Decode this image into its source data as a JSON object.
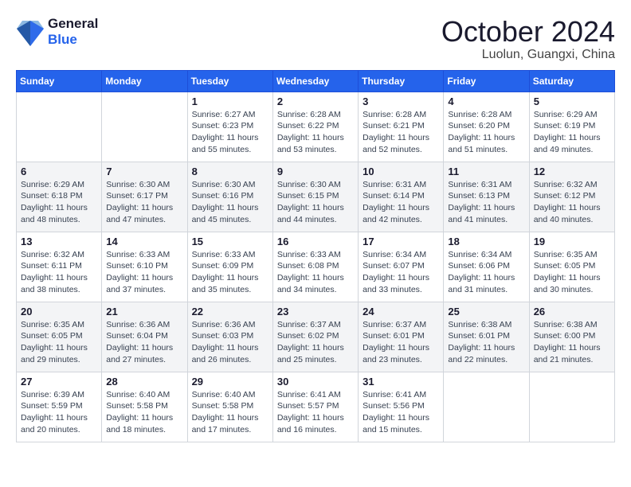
{
  "header": {
    "logo_line1": "General",
    "logo_line2": "Blue",
    "month": "October 2024",
    "location": "Luolun, Guangxi, China"
  },
  "weekdays": [
    "Sunday",
    "Monday",
    "Tuesday",
    "Wednesday",
    "Thursday",
    "Friday",
    "Saturday"
  ],
  "weeks": [
    [
      {
        "day": "",
        "info": ""
      },
      {
        "day": "",
        "info": ""
      },
      {
        "day": "1",
        "info": "Sunrise: 6:27 AM\nSunset: 6:23 PM\nDaylight: 11 hours and 55 minutes."
      },
      {
        "day": "2",
        "info": "Sunrise: 6:28 AM\nSunset: 6:22 PM\nDaylight: 11 hours and 53 minutes."
      },
      {
        "day": "3",
        "info": "Sunrise: 6:28 AM\nSunset: 6:21 PM\nDaylight: 11 hours and 52 minutes."
      },
      {
        "day": "4",
        "info": "Sunrise: 6:28 AM\nSunset: 6:20 PM\nDaylight: 11 hours and 51 minutes."
      },
      {
        "day": "5",
        "info": "Sunrise: 6:29 AM\nSunset: 6:19 PM\nDaylight: 11 hours and 49 minutes."
      }
    ],
    [
      {
        "day": "6",
        "info": "Sunrise: 6:29 AM\nSunset: 6:18 PM\nDaylight: 11 hours and 48 minutes."
      },
      {
        "day": "7",
        "info": "Sunrise: 6:30 AM\nSunset: 6:17 PM\nDaylight: 11 hours and 47 minutes."
      },
      {
        "day": "8",
        "info": "Sunrise: 6:30 AM\nSunset: 6:16 PM\nDaylight: 11 hours and 45 minutes."
      },
      {
        "day": "9",
        "info": "Sunrise: 6:30 AM\nSunset: 6:15 PM\nDaylight: 11 hours and 44 minutes."
      },
      {
        "day": "10",
        "info": "Sunrise: 6:31 AM\nSunset: 6:14 PM\nDaylight: 11 hours and 42 minutes."
      },
      {
        "day": "11",
        "info": "Sunrise: 6:31 AM\nSunset: 6:13 PM\nDaylight: 11 hours and 41 minutes."
      },
      {
        "day": "12",
        "info": "Sunrise: 6:32 AM\nSunset: 6:12 PM\nDaylight: 11 hours and 40 minutes."
      }
    ],
    [
      {
        "day": "13",
        "info": "Sunrise: 6:32 AM\nSunset: 6:11 PM\nDaylight: 11 hours and 38 minutes."
      },
      {
        "day": "14",
        "info": "Sunrise: 6:33 AM\nSunset: 6:10 PM\nDaylight: 11 hours and 37 minutes."
      },
      {
        "day": "15",
        "info": "Sunrise: 6:33 AM\nSunset: 6:09 PM\nDaylight: 11 hours and 35 minutes."
      },
      {
        "day": "16",
        "info": "Sunrise: 6:33 AM\nSunset: 6:08 PM\nDaylight: 11 hours and 34 minutes."
      },
      {
        "day": "17",
        "info": "Sunrise: 6:34 AM\nSunset: 6:07 PM\nDaylight: 11 hours and 33 minutes."
      },
      {
        "day": "18",
        "info": "Sunrise: 6:34 AM\nSunset: 6:06 PM\nDaylight: 11 hours and 31 minutes."
      },
      {
        "day": "19",
        "info": "Sunrise: 6:35 AM\nSunset: 6:05 PM\nDaylight: 11 hours and 30 minutes."
      }
    ],
    [
      {
        "day": "20",
        "info": "Sunrise: 6:35 AM\nSunset: 6:05 PM\nDaylight: 11 hours and 29 minutes."
      },
      {
        "day": "21",
        "info": "Sunrise: 6:36 AM\nSunset: 6:04 PM\nDaylight: 11 hours and 27 minutes."
      },
      {
        "day": "22",
        "info": "Sunrise: 6:36 AM\nSunset: 6:03 PM\nDaylight: 11 hours and 26 minutes."
      },
      {
        "day": "23",
        "info": "Sunrise: 6:37 AM\nSunset: 6:02 PM\nDaylight: 11 hours and 25 minutes."
      },
      {
        "day": "24",
        "info": "Sunrise: 6:37 AM\nSunset: 6:01 PM\nDaylight: 11 hours and 23 minutes."
      },
      {
        "day": "25",
        "info": "Sunrise: 6:38 AM\nSunset: 6:01 PM\nDaylight: 11 hours and 22 minutes."
      },
      {
        "day": "26",
        "info": "Sunrise: 6:38 AM\nSunset: 6:00 PM\nDaylight: 11 hours and 21 minutes."
      }
    ],
    [
      {
        "day": "27",
        "info": "Sunrise: 6:39 AM\nSunset: 5:59 PM\nDaylight: 11 hours and 20 minutes."
      },
      {
        "day": "28",
        "info": "Sunrise: 6:40 AM\nSunset: 5:58 PM\nDaylight: 11 hours and 18 minutes."
      },
      {
        "day": "29",
        "info": "Sunrise: 6:40 AM\nSunset: 5:58 PM\nDaylight: 11 hours and 17 minutes."
      },
      {
        "day": "30",
        "info": "Sunrise: 6:41 AM\nSunset: 5:57 PM\nDaylight: 11 hours and 16 minutes."
      },
      {
        "day": "31",
        "info": "Sunrise: 6:41 AM\nSunset: 5:56 PM\nDaylight: 11 hours and 15 minutes."
      },
      {
        "day": "",
        "info": ""
      },
      {
        "day": "",
        "info": ""
      }
    ]
  ]
}
